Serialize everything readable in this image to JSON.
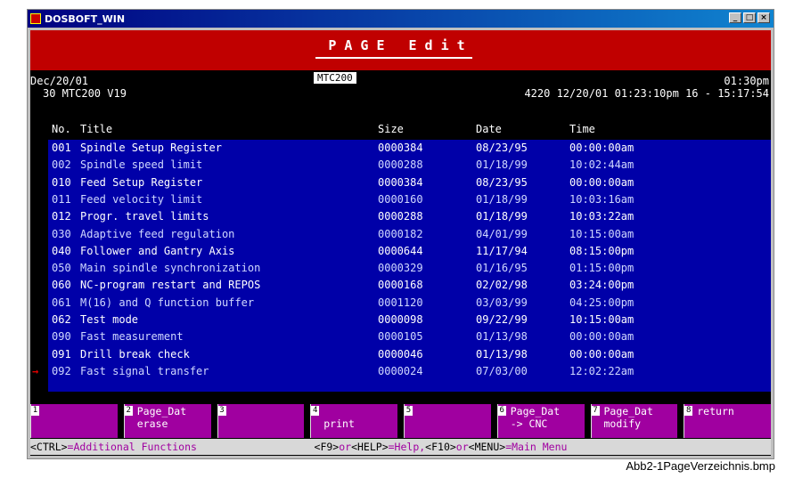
{
  "window": {
    "title": "DOSBOFT_WIN",
    "min": "_",
    "max": "□",
    "close": "×"
  },
  "banner": {
    "title": "PAGE Edit"
  },
  "header": {
    "date": "Dec/20/01",
    "badge": "MTC200",
    "time": "01:30pm",
    "system": "30 MTC200 V19",
    "info": "4220 12/20/01 01:23:10pm 16 - 15:17:54"
  },
  "columns": {
    "no": "No.",
    "title": "Title",
    "size": "Size",
    "date": "Date",
    "time": "Time"
  },
  "rows": [
    {
      "no": "001",
      "title": "Spindle Setup Register",
      "size": "0000384",
      "date": "08/23/95",
      "time": "00:00:00am",
      "bright": true
    },
    {
      "no": "002",
      "title": "Spindle speed limit",
      "size": "0000288",
      "date": "01/18/99",
      "time": "10:02:44am",
      "bright": false
    },
    {
      "no": "010",
      "title": "Feed Setup Register",
      "size": "0000384",
      "date": "08/23/95",
      "time": "00:00:00am",
      "bright": true
    },
    {
      "no": "011",
      "title": "Feed velocity limit",
      "size": "0000160",
      "date": "01/18/99",
      "time": "10:03:16am",
      "bright": false
    },
    {
      "no": "012",
      "title": "Progr. travel limits",
      "size": "0000288",
      "date": "01/18/99",
      "time": "10:03:22am",
      "bright": true
    },
    {
      "no": "030",
      "title": "Adaptive feed regulation",
      "size": "0000182",
      "date": "04/01/99",
      "time": "10:15:00am",
      "bright": false
    },
    {
      "no": "040",
      "title": "Follower and Gantry Axis",
      "size": "0000644",
      "date": "11/17/94",
      "time": "08:15:00pm",
      "bright": true
    },
    {
      "no": "050",
      "title": "Main spindle synchronization",
      "size": "0000329",
      "date": "01/16/95",
      "time": "01:15:00pm",
      "bright": false
    },
    {
      "no": "060",
      "title": "NC-program restart and REPOS",
      "size": "0000168",
      "date": "02/02/98",
      "time": "03:24:00pm",
      "bright": true
    },
    {
      "no": "061",
      "title": "M(16) and Q function buffer",
      "size": "0001120",
      "date": "03/03/99",
      "time": "04:25:00pm",
      "bright": false
    },
    {
      "no": "062",
      "title": "Test mode",
      "size": "0000098",
      "date": "09/22/99",
      "time": "10:15:00am",
      "bright": true
    },
    {
      "no": "090",
      "title": "Fast measurement",
      "size": "0000105",
      "date": "01/13/98",
      "time": "00:00:00am",
      "bright": false
    },
    {
      "no": "091",
      "title": "Drill break check",
      "size": "0000046",
      "date": "01/13/98",
      "time": "00:00:00am",
      "bright": true
    },
    {
      "no": "092",
      "title": "Fast signal transfer",
      "size": "0000024",
      "date": "07/03/00",
      "time": "12:02:22am",
      "bright": false,
      "selected": true
    }
  ],
  "fkeys": [
    {
      "num": "1",
      "line1": "",
      "line2": ""
    },
    {
      "num": "2",
      "line1": "Page_Dat",
      "line2": "erase"
    },
    {
      "num": "3",
      "line1": "",
      "line2": ""
    },
    {
      "num": "4",
      "line1": "",
      "line2": "print"
    },
    {
      "num": "5",
      "line1": "",
      "line2": ""
    },
    {
      "num": "6",
      "line1": "Page_Dat",
      "line2": "-> CNC"
    },
    {
      "num": "7",
      "line1": "Page_Dat",
      "line2": "modify"
    },
    {
      "num": "8",
      "line1": "return",
      "line2": ""
    }
  ],
  "status": {
    "k1": "<CTRL>",
    "t1": "=Additional Functions",
    "k2": "<F9>",
    "t2": "or",
    "k3": "<HELP>",
    "t3": "=Help,",
    "k4": "<F10>",
    "t4": "or",
    "k5": "<MENU>",
    "t5": "=Main Menu"
  },
  "caption": "Abb2-1PageVerzeichnis.bmp",
  "colors": {
    "banner": "#c00000",
    "list_bg": "#0000a8",
    "fkey_bg": "#a000a0",
    "arrow": "#e00000"
  }
}
